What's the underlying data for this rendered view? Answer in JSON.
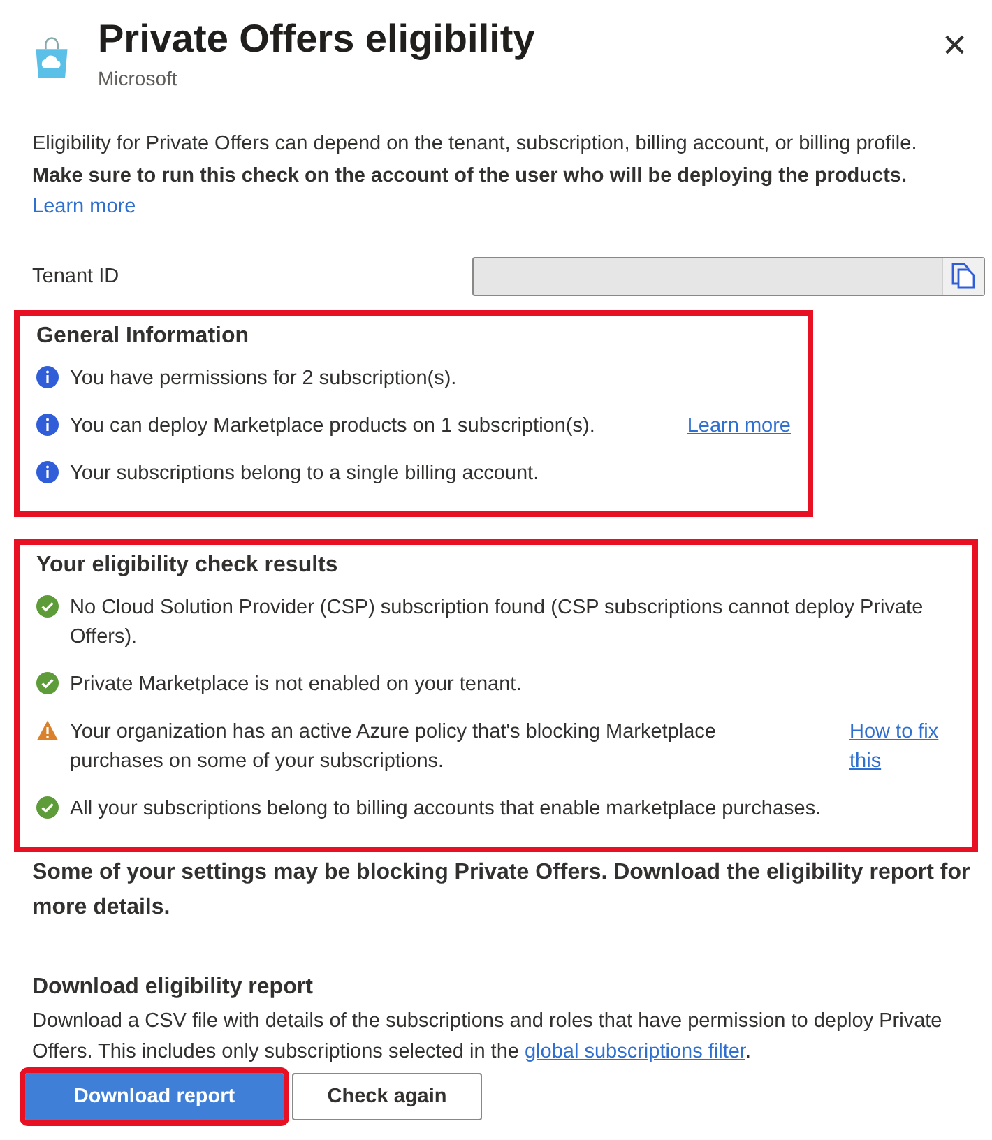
{
  "header": {
    "title": "Private Offers eligibility",
    "subtitle": "Microsoft",
    "close": "×"
  },
  "description": {
    "text": "Eligibility for Private Offers can depend on the tenant, subscription, billing account, or billing profile. **Make sure to run this check on the account of the user who will be deploying the products.**",
    "link": "Learn more"
  },
  "tenant": {
    "label": "Tenant ID"
  },
  "general": {
    "title": "General Information",
    "highlighted": true,
    "items": [
      {
        "kind": "info",
        "text": "You have permissions for 2 subscription(s)."
      },
      {
        "kind": "info",
        "text": "You can deploy Marketplace products on 1 subscription(s).",
        "link": "Learn more"
      },
      {
        "kind": "info",
        "text": "Your subscriptions belong to a single billing account."
      }
    ]
  },
  "results": {
    "title": "Your eligibility check results",
    "highlighted": true,
    "items": [
      {
        "kind": "success",
        "text": "No Cloud Solution Provider (CSP) subscription found (CSP subscriptions cannot deploy Private Offers)."
      },
      {
        "kind": "success",
        "text": "Private Marketplace is not enabled on your tenant."
      },
      {
        "kind": "warning",
        "text": "Your organization has an active Azure policy that's blocking Marketplace purchases on some of your subscriptions.",
        "link": "How to fix this"
      },
      {
        "kind": "success",
        "text": "All your subscriptions belong to billing accounts that enable marketplace purchases."
      }
    ]
  },
  "summary": "Some of your settings may be blocking Private Offers. Download the eligibility report for more details.",
  "report": {
    "title": "Download eligibility report",
    "text_before": "Download a CSV file with details of the subscriptions and roles that have permission to deploy Private Offers. This includes only subscriptions selected in the",
    "link": "global subscriptions filter",
    "text_after": "."
  },
  "buttons": [
    {
      "label": "Download report",
      "kind": "primary",
      "highlighted": true
    },
    {
      "label": "Check again",
      "kind": "secondary",
      "highlighted": false
    }
  ]
}
